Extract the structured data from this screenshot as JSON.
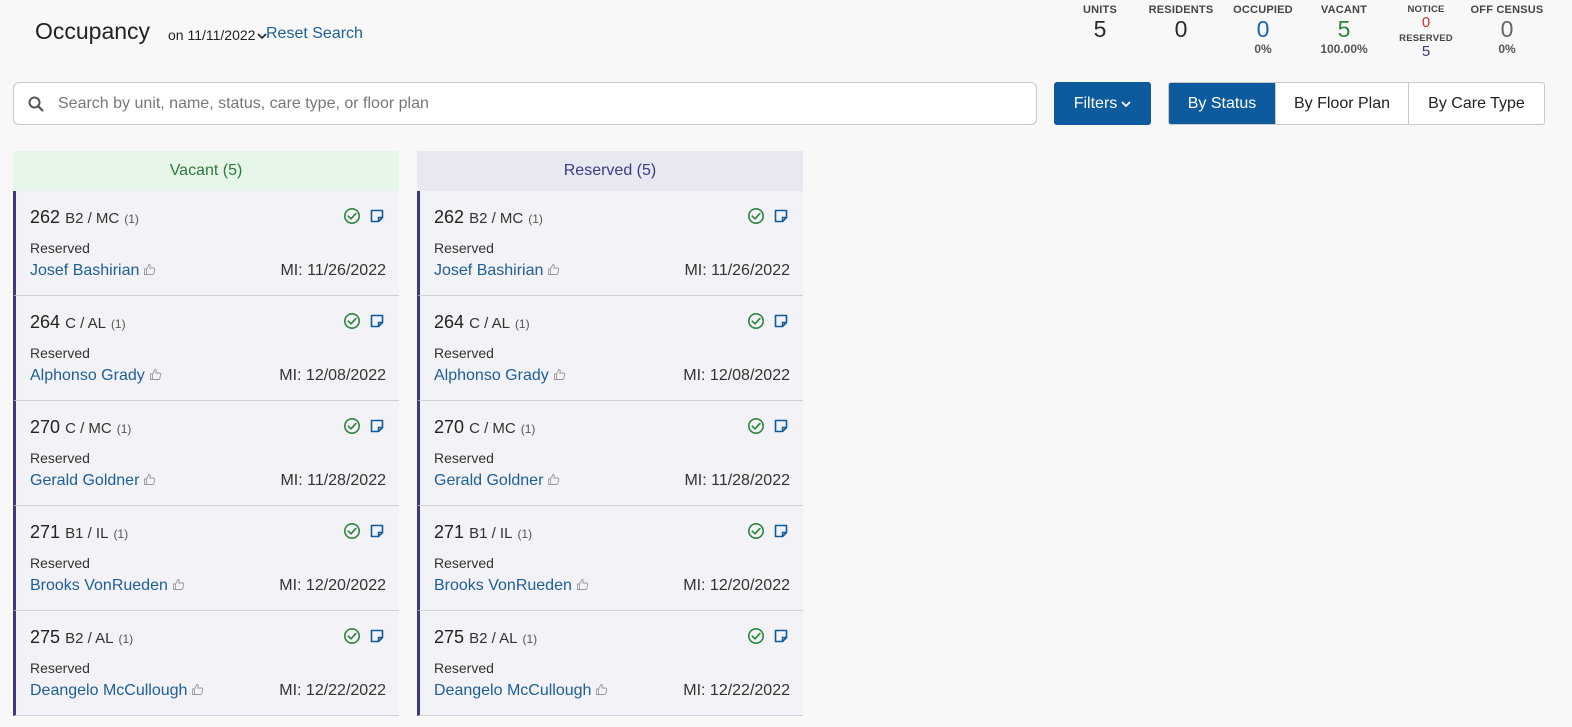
{
  "header": {
    "title": "Occupancy",
    "date_label": "on 11/11/2022",
    "reset_label": "Reset Search"
  },
  "stats": {
    "units": {
      "label": "UNITS",
      "value": "5"
    },
    "residents": {
      "label": "RESIDENTS",
      "value": "0"
    },
    "occupied": {
      "label": "OCCUPIED",
      "value": "0",
      "pct": "0%"
    },
    "vacant": {
      "label": "VACANT",
      "value": "5",
      "pct": "100.00%"
    },
    "notice": {
      "label": "NOTICE",
      "value": "0"
    },
    "reserved": {
      "label": "RESERVED",
      "value": "5"
    },
    "off_census": {
      "label": "OFF CENSUS",
      "value": "0",
      "pct": "0%"
    }
  },
  "colors": {
    "primary": "#0d5a9c",
    "link": "#1d5f95",
    "occupied": "#1a66a8",
    "vacant": "#2e8540",
    "notice": "#d0312d",
    "reserved": "#3c3a82",
    "vacant_header_bg": "#e6f6e8",
    "reserved_header_bg": "#e8e8f1"
  },
  "search": {
    "placeholder": "Search by unit, name, status, care type, or floor plan",
    "value": "",
    "icon": "search-icon"
  },
  "toolbar": {
    "filters_label": "Filters",
    "views": [
      {
        "label": "By Status",
        "active": true
      },
      {
        "label": "By Floor Plan",
        "active": false
      },
      {
        "label": "By Care Type",
        "active": false
      }
    ]
  },
  "columns": [
    {
      "title": "Vacant (5)",
      "cards": [
        {
          "unit": "262",
          "floor_plan": "B2 / MC",
          "count": "(1)",
          "status": "Reserved",
          "name": "Josef Bashirian",
          "move_in": "MI: 11/26/2022"
        },
        {
          "unit": "264",
          "floor_plan": "C / AL",
          "count": "(1)",
          "status": "Reserved",
          "name": "Alphonso Grady",
          "move_in": "MI: 12/08/2022"
        },
        {
          "unit": "270",
          "floor_plan": "C / MC",
          "count": "(1)",
          "status": "Reserved",
          "name": "Gerald Goldner",
          "move_in": "MI: 11/28/2022"
        },
        {
          "unit": "271",
          "floor_plan": "B1 / IL",
          "count": "(1)",
          "status": "Reserved",
          "name": "Brooks VonRueden",
          "move_in": "MI: 12/20/2022"
        },
        {
          "unit": "275",
          "floor_plan": "B2 / AL",
          "count": "(1)",
          "status": "Reserved",
          "name": "Deangelo McCullough",
          "move_in": "MI: 12/22/2022"
        }
      ]
    },
    {
      "title": "Reserved (5)",
      "cards": [
        {
          "unit": "262",
          "floor_plan": "B2 / MC",
          "count": "(1)",
          "status": "Reserved",
          "name": "Josef Bashirian",
          "move_in": "MI: 11/26/2022"
        },
        {
          "unit": "264",
          "floor_plan": "C / AL",
          "count": "(1)",
          "status": "Reserved",
          "name": "Alphonso Grady",
          "move_in": "MI: 12/08/2022"
        },
        {
          "unit": "270",
          "floor_plan": "C / MC",
          "count": "(1)",
          "status": "Reserved",
          "name": "Gerald Goldner",
          "move_in": "MI: 11/28/2022"
        },
        {
          "unit": "271",
          "floor_plan": "B1 / IL",
          "count": "(1)",
          "status": "Reserved",
          "name": "Brooks VonRueden",
          "move_in": "MI: 12/20/2022"
        },
        {
          "unit": "275",
          "floor_plan": "B2 / AL",
          "count": "(1)",
          "status": "Reserved",
          "name": "Deangelo McCullough",
          "move_in": "MI: 12/22/2022"
        }
      ]
    }
  ]
}
